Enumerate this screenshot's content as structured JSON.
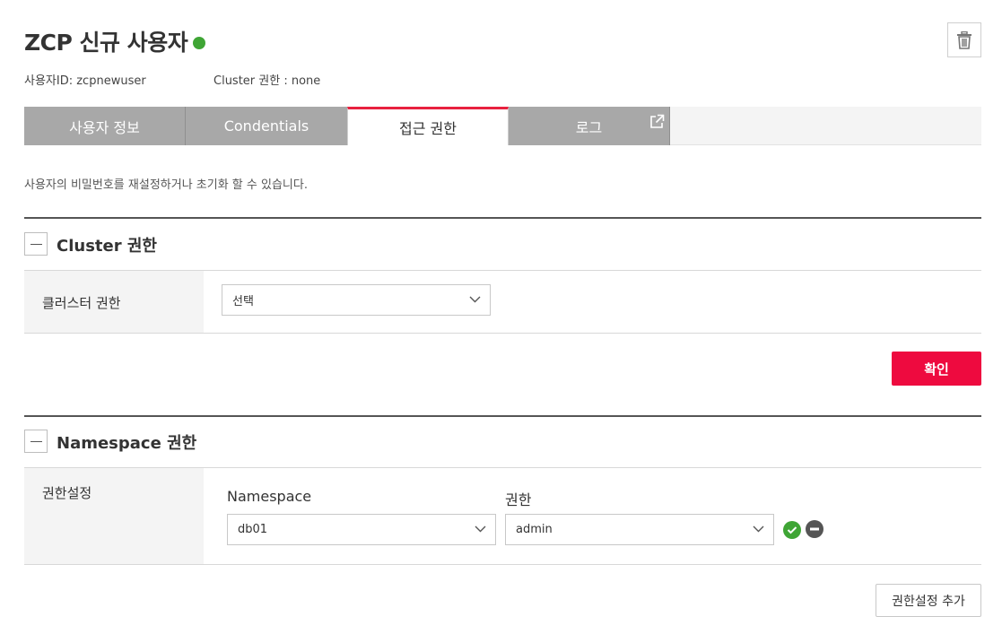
{
  "header": {
    "title": "ZCP 신규 사용자",
    "user_id": "사용자ID: zcpnewuser",
    "cluster_role": "Cluster 권한 : none",
    "status_color": "#3fa535"
  },
  "tabs": [
    {
      "label": "사용자 정보",
      "active": false
    },
    {
      "label": "Condentials",
      "active": false
    },
    {
      "label": "접근 권한",
      "active": true
    },
    {
      "label": "로그",
      "active": false
    }
  ],
  "description": "사용자의 비밀번호를 재설정하거나 초기화 할 수 있습니다.",
  "cluster_section": {
    "title": "Cluster 권한",
    "row_label": "클러스터 권한",
    "select_value": "선택",
    "confirm_label": "확인"
  },
  "namespace_section": {
    "title": "Namespace 권한",
    "row_label": "권한설정",
    "namespace_label": "Namespace",
    "role_label": "권한",
    "namespace_value": "db01",
    "role_value": "admin",
    "add_label": "권한설정 추가"
  },
  "colors": {
    "accent": "#ee0a3f",
    "tab_active_border": "#e8213f",
    "tab_inactive": "#a8a8a8",
    "ok": "#3fa535",
    "remove": "#555555"
  }
}
